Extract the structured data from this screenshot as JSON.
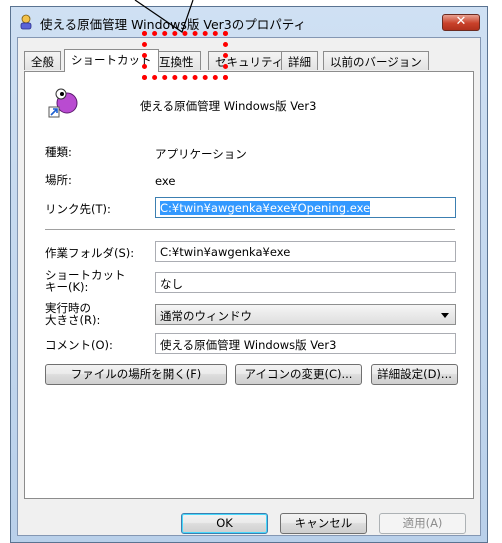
{
  "window": {
    "title": "使える原価管理 Windows版 Ver3のプロパティ",
    "close_label": "✕"
  },
  "tabs": [
    "全般",
    "ショートカット",
    "互換性",
    "セキュリティ",
    "詳細",
    "以前のバージョン"
  ],
  "app": {
    "name": "使える原価管理 Windows版 Ver3",
    "icon": "shortcut-app-icon"
  },
  "fields": {
    "type_label": "種類:",
    "type_value": "アプリケーション",
    "location_label": "場所:",
    "location_value": "exe",
    "target_label": "リンク先(T):",
    "target_value": "C:¥twin¥awgenka¥exe¥Opening.exe",
    "start_in_label": "作業フォルダ(S):",
    "start_in_value": "C:¥twin¥awgenka¥exe",
    "shortcut_key_label_1": "ショートカット",
    "shortcut_key_label_2": "キー(K):",
    "shortcut_key_value": "なし",
    "run_label_1": "実行時の",
    "run_label_2": "大きさ(R):",
    "run_value": "通常のウィンドウ",
    "comment_label": "コメント(O):",
    "comment_value": "使える原価管理 Windows版 Ver3"
  },
  "buttons": {
    "open_location": "ファイルの場所を開く(F)",
    "change_icon": "アイコンの変更(C)...",
    "advanced": "詳細設定(D)...",
    "ok": "OK",
    "cancel": "キャンセル",
    "apply": "適用(A)"
  },
  "colors": {
    "selection": "#3399ff",
    "highlight": "#ff0000",
    "default_button": "#3c7fb1"
  }
}
